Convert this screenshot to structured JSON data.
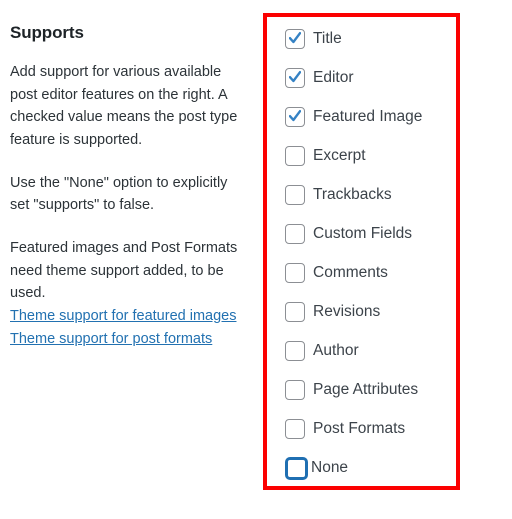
{
  "panel": {
    "title": "Supports",
    "paragraphs": [
      "Add support for various available post editor features on the right. A checked value means the post type feature is supported.",
      "Use the \"None\" option to explicitly set \"supports\" to false.",
      "Featured images and Post Formats need theme support added, to be used."
    ],
    "links": [
      {
        "label": "Theme support for featured images"
      },
      {
        "label": "Theme support for post formats"
      }
    ]
  },
  "supports_options": [
    {
      "label": "Title",
      "checked": true,
      "focused": false
    },
    {
      "label": "Editor",
      "checked": true,
      "focused": false
    },
    {
      "label": "Featured Image",
      "checked": true,
      "focused": false
    },
    {
      "label": "Excerpt",
      "checked": false,
      "focused": false
    },
    {
      "label": "Trackbacks",
      "checked": false,
      "focused": false
    },
    {
      "label": "Custom Fields",
      "checked": false,
      "focused": false
    },
    {
      "label": "Comments",
      "checked": false,
      "focused": false
    },
    {
      "label": "Revisions",
      "checked": false,
      "focused": false
    },
    {
      "label": "Author",
      "checked": false,
      "focused": false
    },
    {
      "label": "Page Attributes",
      "checked": false,
      "focused": false
    },
    {
      "label": "Post Formats",
      "checked": false,
      "focused": false
    },
    {
      "label": "None",
      "checked": false,
      "focused": true
    }
  ],
  "annotation": {
    "shape": "rectangle-highlight",
    "color": "#fb0000"
  },
  "colors": {
    "link": "#2271b1",
    "heading": "#1d2327",
    "body_text": "#2c3338",
    "label_text": "#3c434a",
    "checkbox_border": "#8c8f94",
    "check_mark": "#3582c4",
    "focus_ring": "#1f6fb2",
    "annotation_red": "#fb0000",
    "background": "#ffffff"
  }
}
